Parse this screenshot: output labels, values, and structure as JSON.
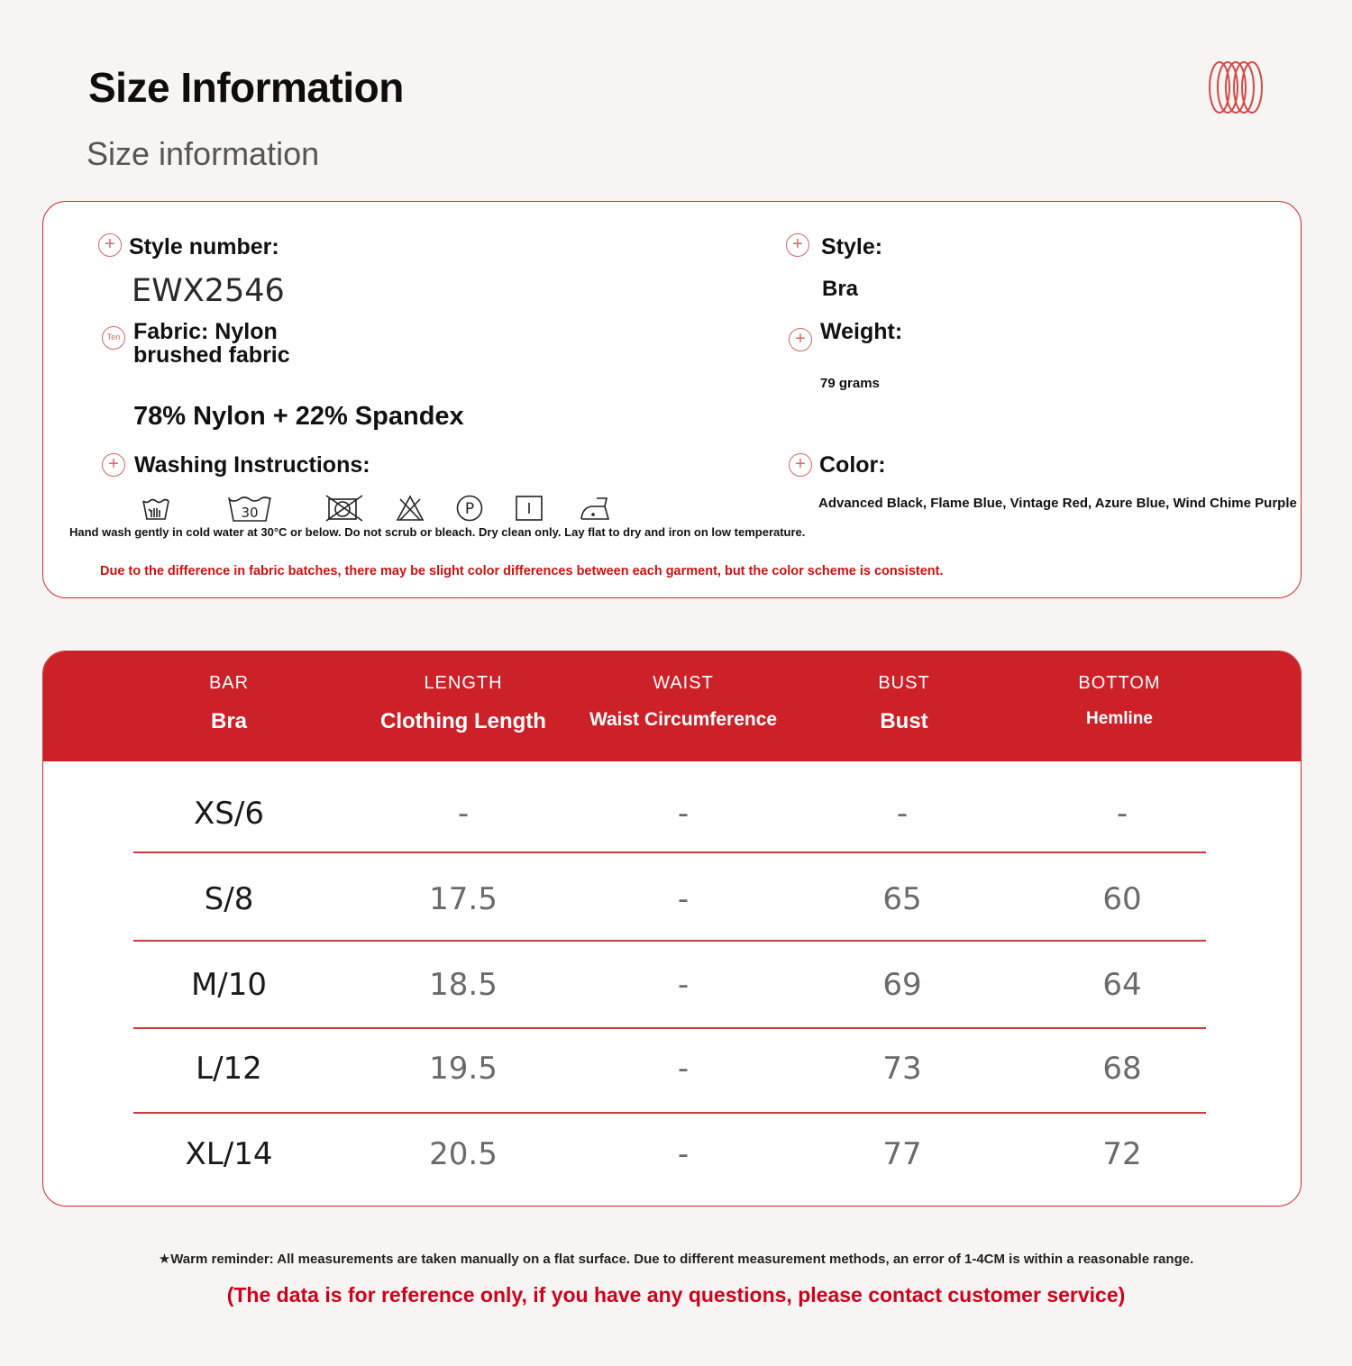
{
  "header": {
    "title": "Size Information",
    "subtitle": "Size information"
  },
  "info": {
    "style_number_label": "Style number:",
    "style_number_value": "EWX2546",
    "fabric_label": "Fabric: Nylon\nbrushed fabric",
    "fabric_badge": "Ten",
    "fabric_value": "78% Nylon + 22% Spandex",
    "washing_label": "Washing Instructions:",
    "washing_icon_temp": "30",
    "washing_note": "Hand wash gently in cold water at 30°C or below. Do not scrub or bleach. Dry clean only. Lay flat to dry and iron on low temperature.",
    "color_note": "Due to the difference in fabric batches, there may be slight color differences between each garment, but the color scheme is consistent.",
    "style_label": "Style:",
    "style_value": "Bra",
    "weight_label": "Weight:",
    "weight_value": "79 grams",
    "color_label": "Color:",
    "color_value": "Advanced Black, Flame Blue, Vintage Red, Azure Blue, Wind Chime Purple",
    "washing_icons": [
      "hand-wash-icon",
      "wash-30-icon",
      "no-tumble-dry-icon",
      "no-bleach-icon",
      "dry-clean-p-icon",
      "line-dry-icon",
      "iron-low-icon"
    ]
  },
  "table": {
    "columns": [
      {
        "en": "BAR",
        "cn": "Bra"
      },
      {
        "en": "LENGTH",
        "cn": "Clothing Length"
      },
      {
        "en": "WAIST",
        "cn": "Waist Circumference"
      },
      {
        "en": "BUST",
        "cn": "Bust"
      },
      {
        "en": "BOTTOM",
        "cn": "Hemline"
      }
    ],
    "rows": [
      [
        "XS/6",
        "-",
        "-",
        "-",
        "-"
      ],
      [
        "S/8",
        "17.5",
        "-",
        "65",
        "60"
      ],
      [
        "M/10",
        "18.5",
        "-",
        "69",
        "64"
      ],
      [
        "L/12",
        "19.5",
        "-",
        "73",
        "68"
      ],
      [
        "XL/14",
        "20.5",
        "-",
        "77",
        "72"
      ]
    ]
  },
  "footer": {
    "reminder": "★Warm reminder: All measurements are taken manually on a flat surface. Due to different measurement methods, an error of 1-4CM is within a reasonable range.",
    "contact": "(The data is for reference only, if you have any questions, please contact customer service)"
  },
  "colors": {
    "accent_red": "#cd2129",
    "note_red": "#d0021b",
    "icon_pink": "#d76666"
  }
}
